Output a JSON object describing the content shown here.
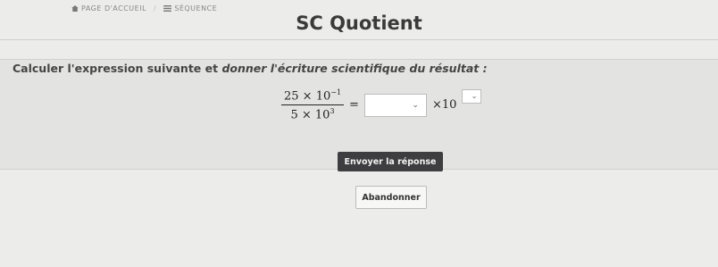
{
  "breadcrumb": {
    "home_label": "PAGE D'ACCUEIL",
    "sequence_label": "SÉQUENCE"
  },
  "title": "SC Quotient",
  "question": {
    "prefix": "Calculer l'expression suivante et ",
    "emphasis": "donner l'écriture scientifique du résultat :"
  },
  "expression": {
    "numerator_mantissa": "25 × 10",
    "numerator_exponent": "−1",
    "denominator_mantissa": "5 × 10",
    "denominator_exponent": "3",
    "equals": "=",
    "times_ten": "×10"
  },
  "buttons": {
    "submit_label": "Envoyer la réponse",
    "abort_label": "Abandonner"
  },
  "icons": {
    "home": "home-icon",
    "sequence": "list-icon",
    "dropdown": "chevron-down-icon"
  }
}
